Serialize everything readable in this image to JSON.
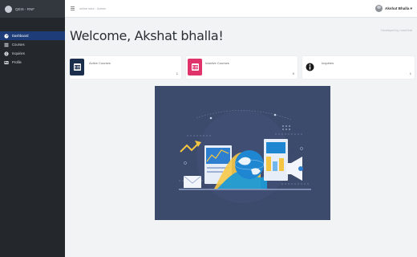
{
  "sidebar": {
    "brand": "QEIS - RNF",
    "items": [
      {
        "label": "Dashboard",
        "icon": "dashboard-icon",
        "active": true
      },
      {
        "label": "Courses",
        "icon": "list-icon",
        "active": false
      },
      {
        "label": "Inquiries",
        "icon": "info-icon",
        "active": false
      },
      {
        "label": "Profile",
        "icon": "profile-card-icon",
        "active": false
      }
    ]
  },
  "topbar": {
    "breadcrumb": "online tutor - Admin",
    "user_name": "Akshat Bhalla ▾"
  },
  "main": {
    "title": "Welcome, Akshat bhalla!",
    "dev_note": "Developed by LearnHub"
  },
  "cards": [
    {
      "label": "Active Courses",
      "value": "1",
      "icon": "grid-icon",
      "color": "#1b2f4d"
    },
    {
      "label": "Inactive Courses",
      "value": "0",
      "icon": "grid-icon",
      "color": "#e0336b"
    },
    {
      "label": "Inquiries",
      "value": "1",
      "icon": "info-icon",
      "color": "#ffffff"
    }
  ],
  "colors": {
    "sidebar_bg": "#24272c",
    "active_nav": "#1e3d78",
    "hero_bg": "#3c4a6b"
  }
}
